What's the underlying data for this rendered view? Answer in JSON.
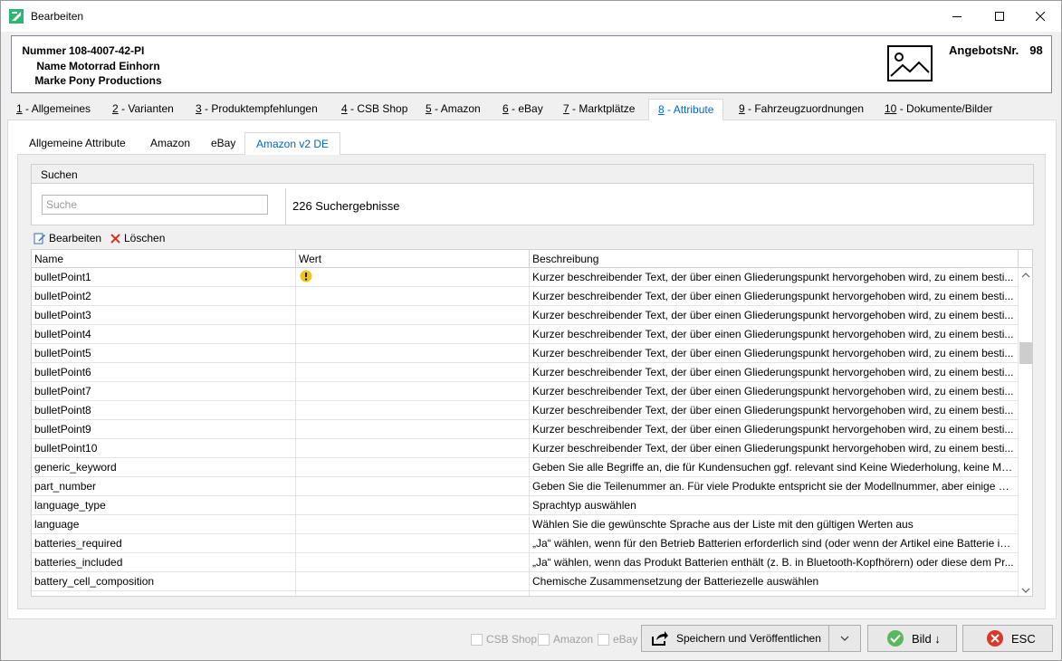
{
  "window": {
    "title": "Bearbeiten",
    "accent_color": "#0066cc"
  },
  "header": {
    "rows": [
      {
        "label": "Nummer",
        "value": "108-4007-42-PI"
      },
      {
        "label": "Name",
        "value": "Motorrad Einhorn"
      },
      {
        "label": "Marke",
        "value": "Pony Productions"
      }
    ],
    "angebot_label": "AngebotsNr.",
    "angebot_value": "98"
  },
  "main_tabs": [
    {
      "key": "1",
      "label": " - Allgemeines"
    },
    {
      "key": "2",
      "label": " - Varianten"
    },
    {
      "key": "3",
      "label": " - Produktempfehlungen"
    },
    {
      "key": "4",
      "label": " - CSB Shop"
    },
    {
      "key": "5",
      "label": " - Amazon"
    },
    {
      "key": "6",
      "label": " - eBay"
    },
    {
      "key": "7",
      "label": " - Marktplätze"
    },
    {
      "key": "8",
      "label": " - Attribute",
      "active": true
    },
    {
      "key": "9",
      "label": " - Fahrzeugzuordnungen"
    },
    {
      "key": "10",
      "label": " - Dokumente/Bilder"
    }
  ],
  "inner_tabs": [
    {
      "label": "Allgemeine Attribute"
    },
    {
      "label": "Amazon"
    },
    {
      "label": "eBay"
    },
    {
      "label": "Amazon v2 DE",
      "active": true
    }
  ],
  "search": {
    "group_title": "Suchen",
    "placeholder": "Suche",
    "value": "",
    "result_count": "226 Suchergebnisse"
  },
  "toolbar": {
    "edit_label": "Bearbeiten",
    "delete_label": "Löschen"
  },
  "grid": {
    "columns": [
      "Name",
      "Wert",
      "Beschreibung"
    ],
    "rows": [
      {
        "name": "bulletPoint1",
        "wert": "",
        "warning": true,
        "desc": "Kurzer beschreibender Text, der über einen Gliederungspunkt hervorgehoben wird, zu einem besti..."
      },
      {
        "name": "bulletPoint2",
        "wert": "",
        "desc": "Kurzer beschreibender Text, der über einen Gliederungspunkt hervorgehoben wird, zu einem besti..."
      },
      {
        "name": "bulletPoint3",
        "wert": "",
        "desc": "Kurzer beschreibender Text, der über einen Gliederungspunkt hervorgehoben wird, zu einem besti..."
      },
      {
        "name": "bulletPoint4",
        "wert": "",
        "desc": "Kurzer beschreibender Text, der über einen Gliederungspunkt hervorgehoben wird, zu einem besti..."
      },
      {
        "name": "bulletPoint5",
        "wert": "",
        "desc": "Kurzer beschreibender Text, der über einen Gliederungspunkt hervorgehoben wird, zu einem besti..."
      },
      {
        "name": "bulletPoint6",
        "wert": "",
        "desc": "Kurzer beschreibender Text, der über einen Gliederungspunkt hervorgehoben wird, zu einem besti..."
      },
      {
        "name": "bulletPoint7",
        "wert": "",
        "desc": "Kurzer beschreibender Text, der über einen Gliederungspunkt hervorgehoben wird, zu einem besti..."
      },
      {
        "name": "bulletPoint8",
        "wert": "",
        "desc": "Kurzer beschreibender Text, der über einen Gliederungspunkt hervorgehoben wird, zu einem besti..."
      },
      {
        "name": "bulletPoint9",
        "wert": "",
        "desc": "Kurzer beschreibender Text, der über einen Gliederungspunkt hervorgehoben wird, zu einem besti..."
      },
      {
        "name": "bulletPoint10",
        "wert": "",
        "desc": "Kurzer beschreibender Text, der über einen Gliederungspunkt hervorgehoben wird, zu einem besti..."
      },
      {
        "name": "generic_keyword",
        "wert": "",
        "desc": "Geben Sie alle Begriffe an, die für Kundensuchen ggf. relevant sind Keine Wiederholung, keine Mar..."
      },
      {
        "name": "part_number",
        "wert": "",
        "desc": "Geben Sie die Teilenummer an. Für viele Produkte entspricht sie der Modellnummer, aber einige H..."
      },
      {
        "name": "language_type",
        "wert": "",
        "desc": "Sprachtyp auswählen"
      },
      {
        "name": "language",
        "wert": "",
        "desc": "Wählen Sie die gewünschte Sprache aus der Liste mit den gültigen Werten aus"
      },
      {
        "name": "batteries_required",
        "wert": "",
        "desc": "„Ja“ wählen, wenn für den Betrieb Batterien erforderlich sind (oder wenn der Artikel eine Batterie is..."
      },
      {
        "name": "batteries_included",
        "wert": "",
        "desc": "„Ja“ wählen, wenn das Produkt Batterien enthält (z. B. in Bluetooth-Kopfhörern) oder diese dem Pr..."
      },
      {
        "name": "battery_cell_composition",
        "wert": "",
        "desc": "Chemische Zusammensetzung der Batteriezelle auswählen"
      },
      {
        "name": "",
        "wert": "",
        "desc": ""
      }
    ]
  },
  "bottom": {
    "checkboxes": [
      {
        "label": "CSB Shop",
        "checked": false
      },
      {
        "label": "Amazon",
        "checked": false
      },
      {
        "label": "eBay",
        "checked": false
      }
    ],
    "publish_label": "Speichern und Veröffentlichen",
    "bild_label": "Bild ↓",
    "esc_label": "ESC"
  }
}
